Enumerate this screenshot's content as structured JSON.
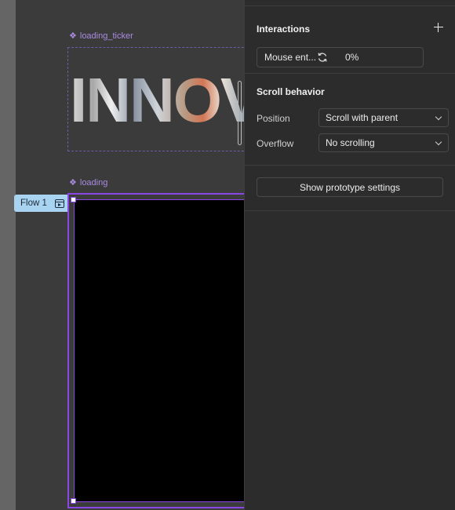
{
  "canvas": {
    "ticker_frame": {
      "label": "loading_ticker",
      "text": "INNOVA"
    },
    "loading_frame": {
      "label": "loading"
    },
    "flow_badge": {
      "label": "Flow 1"
    }
  },
  "panel": {
    "interactions": {
      "title": "Interactions",
      "row": {
        "trigger": "Mouse ent...",
        "value": "0%"
      }
    },
    "scroll_behavior": {
      "title": "Scroll behavior",
      "position_label": "Position",
      "position_value": "Scroll with parent",
      "overflow_label": "Overflow",
      "overflow_value": "No scrolling"
    },
    "prototype": {
      "button_label": "Show prototype settings"
    }
  },
  "colors": {
    "selection": "#8a46e6",
    "component_label": "#a98be0",
    "flow_badge": "#a8d3f1",
    "panel_bg": "#2c2c2c",
    "canvas_bg": "#3b3b3b"
  }
}
